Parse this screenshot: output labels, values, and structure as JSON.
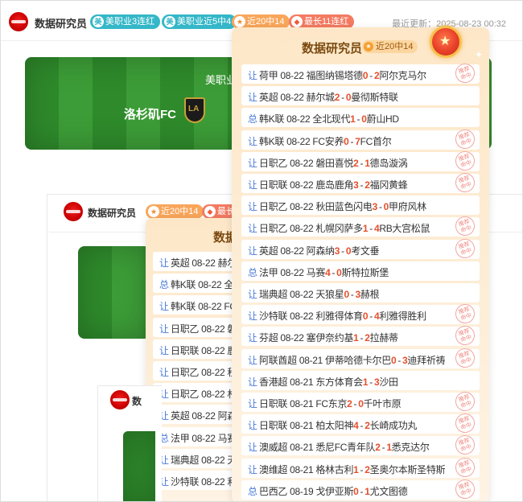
{
  "header": {
    "author": "数据研究员",
    "badges": [
      {
        "icon": "美",
        "text": "美职业3连红",
        "style": "teal"
      },
      {
        "icon": "美",
        "text": "美职业近5中4",
        "style": "teal"
      },
      {
        "icon": "★",
        "text": "近20中14",
        "style": "orange"
      },
      {
        "icon": "◆",
        "text": "最长11连红",
        "style": "red"
      }
    ],
    "update": "最近更新：2025-08-23 00:32"
  },
  "banner": {
    "team": "洛杉矶FC",
    "league": "美职业"
  },
  "popup": {
    "title": "数据研究员",
    "badge": "近20中14",
    "stamp": "推荐\n命中",
    "rows": [
      {
        "tag": "让",
        "pre": "荷甲 08-22 福图纳锡塔德",
        "s1": "0",
        "s2": "2",
        "post": "阿尔克马尔",
        "hit": true
      },
      {
        "tag": "让",
        "pre": "英超 08-22 赫尔城",
        "s1": "2",
        "s2": "0",
        "post": "曼彻斯特联",
        "hit": false
      },
      {
        "tag": "总",
        "pre": "韩K联 08-22 全北现代",
        "s1": "1",
        "s2": "0",
        "post": "蔚山HD",
        "hit": false
      },
      {
        "tag": "让",
        "pre": "韩K联 08-22 FC安养",
        "s1": "0",
        "s2": "7",
        "post": "FC首尔",
        "hit": true
      },
      {
        "tag": "让",
        "pre": "日职乙 08-22 磐田喜悦",
        "s1": "2",
        "s2": "1",
        "post": "德岛漩涡",
        "hit": true
      },
      {
        "tag": "让",
        "pre": "日职联 08-22 鹿岛鹿角",
        "s1": "3",
        "s2": "2",
        "post": "福冈黄蜂",
        "hit": true
      },
      {
        "tag": "让",
        "pre": "日职乙 08-22 秋田蓝色闪电",
        "s1": "3",
        "s2": "0",
        "post": "甲府风林",
        "hit": false
      },
      {
        "tag": "让",
        "pre": "日职乙 08-22 札幌冈萨多",
        "s1": "1",
        "s2": "4",
        "post": "RB大宫松鼠",
        "hit": true
      },
      {
        "tag": "让",
        "pre": "英超 08-22 阿森纳",
        "s1": "3",
        "s2": "0",
        "post": "考文垂",
        "hit": true
      },
      {
        "tag": "总",
        "pre": "法甲 08-22 马赛",
        "s1": "4",
        "s2": "0",
        "post": "斯特拉斯堡",
        "hit": false
      },
      {
        "tag": "让",
        "pre": "瑞典超 08-22 天狼星",
        "s1": "0",
        "s2": "3",
        "post": "赫根",
        "hit": false
      },
      {
        "tag": "让",
        "pre": "沙特联 08-22 利雅得体育",
        "s1": "0",
        "s2": "4",
        "post": "利雅得胜利",
        "hit": true
      },
      {
        "tag": "让",
        "pre": "芬超 08-22 塞伊奈约基",
        "s1": "1",
        "s2": "2",
        "post": "拉赫蒂",
        "hit": true
      },
      {
        "tag": "让",
        "pre": "阿联酋超 08-21 伊蒂哈德卡尔巴",
        "s1": "0",
        "s2": "3",
        "post": "迪拜祈祷",
        "hit": true
      },
      {
        "tag": "让",
        "pre": "香港超 08-21 东方体育会",
        "s1": "1",
        "s2": "3",
        "post": "沙田",
        "hit": false
      },
      {
        "tag": "让",
        "pre": "日职联 08-21 FC东京",
        "s1": "2",
        "s2": "0",
        "post": "千叶市原",
        "hit": true
      },
      {
        "tag": "让",
        "pre": "日职联 08-21 柏太阳神",
        "s1": "4",
        "s2": "2",
        "post": "长崎成功丸",
        "hit": true
      },
      {
        "tag": "让",
        "pre": "澳威超 08-21 悉尼FC青年队",
        "s1": "2",
        "s2": "1",
        "post": "悉克达尔",
        "hit": true
      },
      {
        "tag": "让",
        "pre": "澳维超 08-21 格林古利",
        "s1": "1",
        "s2": "2",
        "post": "圣奥尔本斯圣特斯",
        "hit": true
      },
      {
        "tag": "总",
        "pre": "巴西乙 08-19 戈伊亚斯",
        "s1": "0",
        "s2": "1",
        "post": "尤文图德",
        "hit": true
      }
    ]
  },
  "echo": {
    "author": "数据研究员",
    "badge1": "近20中14",
    "badge2": "最长",
    "title": "数据",
    "rows": [
      {
        "tag": "让",
        "text": "英超 08-22 赫尔"
      },
      {
        "tag": "总",
        "text": "韩K联 08-22 全北"
      },
      {
        "tag": "让",
        "text": "韩K联 08-22 FC"
      },
      {
        "tag": "让",
        "text": "日职乙 08-22 磐"
      },
      {
        "tag": "让",
        "text": "日职联 08-22 鹿"
      },
      {
        "tag": "让",
        "text": "日职乙 08-22 秋"
      },
      {
        "tag": "让",
        "text": "日职乙 08-22 札"
      },
      {
        "tag": "让",
        "text": "英超 08-22 阿森"
      },
      {
        "tag": "总",
        "text": "法甲 08-22 马赛"
      },
      {
        "tag": "让",
        "text": "瑞典超 08-22 天"
      },
      {
        "tag": "让",
        "text": "沙特联 08-22 利"
      }
    ],
    "author3": "数"
  }
}
